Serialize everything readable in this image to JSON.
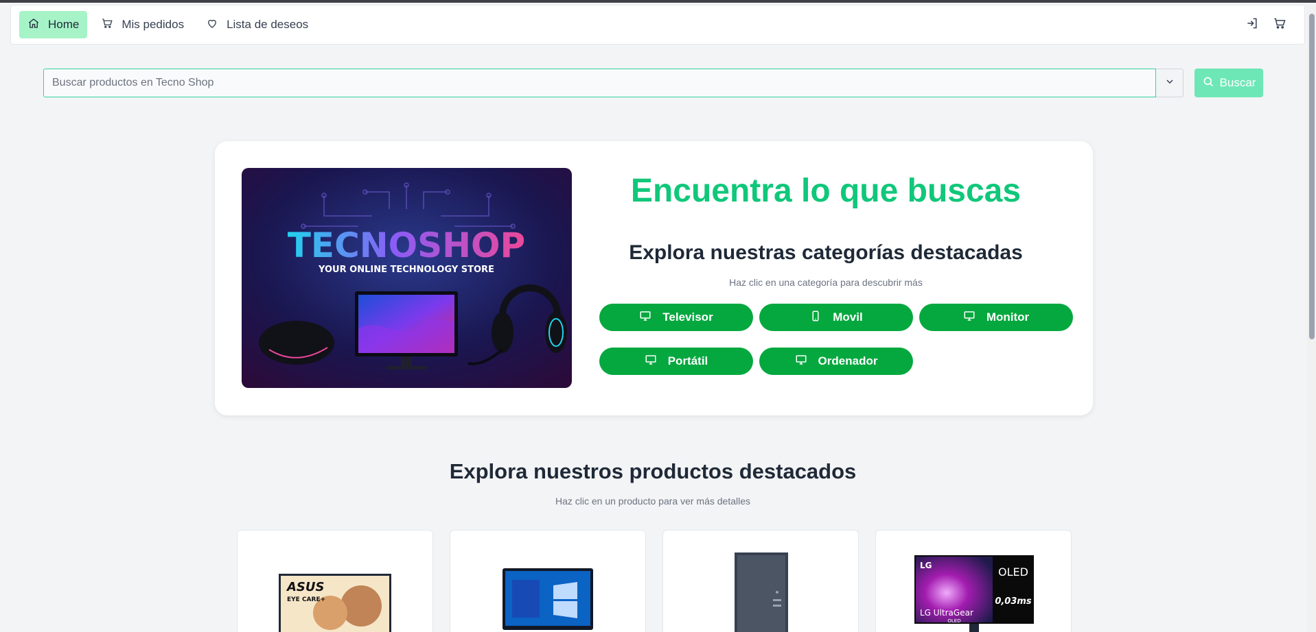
{
  "nav": {
    "items": [
      {
        "label": "Home",
        "icon": "home-icon"
      },
      {
        "label": "Mis pedidos",
        "icon": "cart-icon"
      },
      {
        "label": "Lista de deseos",
        "icon": "heart-icon"
      }
    ],
    "right_icons": [
      "login-icon",
      "cart-icon"
    ]
  },
  "search": {
    "placeholder": "Buscar productos en Tecno Shop",
    "button_label": "Buscar"
  },
  "hero": {
    "banner_brand": "TECNOSHOP",
    "banner_tagline": "YOUR ONLINE TECHNOLOGY STORE",
    "title": "Encuentra lo que buscas",
    "subtitle": "Explora nuestras categorías destacadas",
    "hint": "Haz clic en una categoría para descubrir más",
    "categories": [
      {
        "label": "Televisor",
        "icon": "monitor-icon"
      },
      {
        "label": "Movil",
        "icon": "smartphone-icon"
      },
      {
        "label": "Monitor",
        "icon": "monitor-icon"
      },
      {
        "label": "Portátil",
        "icon": "monitor-icon"
      },
      {
        "label": "Ordenador",
        "icon": "monitor-icon"
      }
    ]
  },
  "products": {
    "title": "Explora nuestros productos destacados",
    "hint": "Haz clic en un producto para ver más detalles",
    "cards": [
      {
        "brand_text": "ASUS",
        "badge_text": "EYE CARE+"
      },
      {
        "brand_text": ""
      },
      {
        "brand_text": ""
      },
      {
        "brand_text": "LG",
        "badge_text": "OLED",
        "model_text": "LG UltraGear",
        "sub_text": "OLED",
        "spec_text": "0,03ms"
      }
    ]
  },
  "colors": {
    "accent": "#10c77a",
    "category_button": "#05a83f",
    "nav_active": "#a7f3c8",
    "search_button": "#6ee7b7"
  }
}
